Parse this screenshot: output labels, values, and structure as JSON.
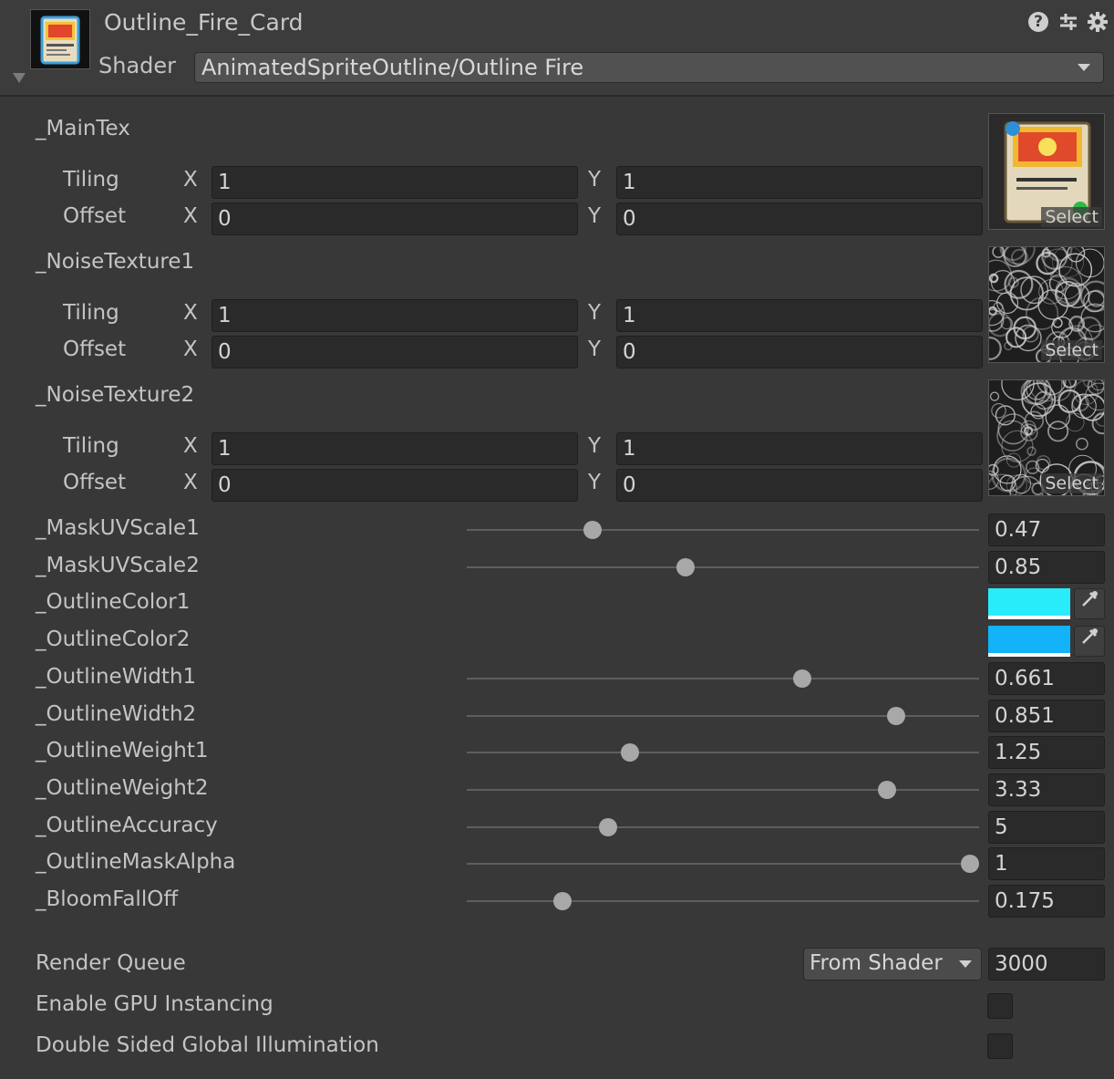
{
  "header": {
    "title": "Outline_Fire_Card",
    "shader_label": "Shader",
    "shader_value": "AnimatedSpriteOutline/Outline Fire"
  },
  "textures": [
    {
      "name": "_MainTex",
      "tiling_label": "Tiling",
      "offset_label": "Offset",
      "tiling_x": "1",
      "tiling_y": "1",
      "offset_x": "0",
      "offset_y": "0",
      "select_label": "Select",
      "thumb": "card-texture"
    },
    {
      "name": "_NoiseTexture1",
      "tiling_label": "Tiling",
      "offset_label": "Offset",
      "tiling_x": "1",
      "tiling_y": "1",
      "offset_x": "0",
      "offset_y": "0",
      "select_label": "Select",
      "thumb": "noise-texture"
    },
    {
      "name": "_NoiseTexture2",
      "tiling_label": "Tiling",
      "offset_label": "Offset",
      "tiling_x": "1",
      "tiling_y": "1",
      "offset_x": "0",
      "offset_y": "0",
      "select_label": "Select",
      "thumb": "noise-texture"
    }
  ],
  "axis_labels": {
    "x": "X",
    "y": "Y"
  },
  "properties": [
    {
      "name": "_MaskUVScale1",
      "kind": "slider",
      "value": "0.47",
      "fraction": 0.245
    },
    {
      "name": "_MaskUVScale2",
      "kind": "slider",
      "value": "0.85",
      "fraction": 0.427
    },
    {
      "name": "_OutlineColor1",
      "kind": "color",
      "color": "#29ecfb"
    },
    {
      "name": "_OutlineColor2",
      "kind": "color",
      "color": "#12b3f8"
    },
    {
      "name": "_OutlineWidth1",
      "kind": "slider",
      "value": "0.661",
      "fraction": 0.654
    },
    {
      "name": "_OutlineWidth2",
      "kind": "slider",
      "value": "0.851",
      "fraction": 0.838
    },
    {
      "name": "_OutlineWeight1",
      "kind": "slider",
      "value": "1.25",
      "fraction": 0.318
    },
    {
      "name": "_OutlineWeight2",
      "kind": "slider",
      "value": "3.33",
      "fraction": 0.82
    },
    {
      "name": "_OutlineAccuracy",
      "kind": "slider",
      "value": "5",
      "fraction": 0.275
    },
    {
      "name": "_OutlineMaskAlpha",
      "kind": "slider",
      "value": "1",
      "fraction": 0.982
    },
    {
      "name": "_BloomFallOff",
      "kind": "slider",
      "value": "0.175",
      "fraction": 0.186
    }
  ],
  "render_queue": {
    "label": "Render Queue",
    "mode": "From Shader",
    "value": "3000"
  },
  "gpu_instancing": {
    "label": "Enable GPU Instancing",
    "checked": false
  },
  "double_sided_gi": {
    "label": "Double Sided Global Illumination",
    "checked": false
  },
  "icons": {
    "help": "help-icon",
    "preset": "preset-icon",
    "settings": "gear-icon",
    "eyedropper": "eyedropper-icon"
  }
}
